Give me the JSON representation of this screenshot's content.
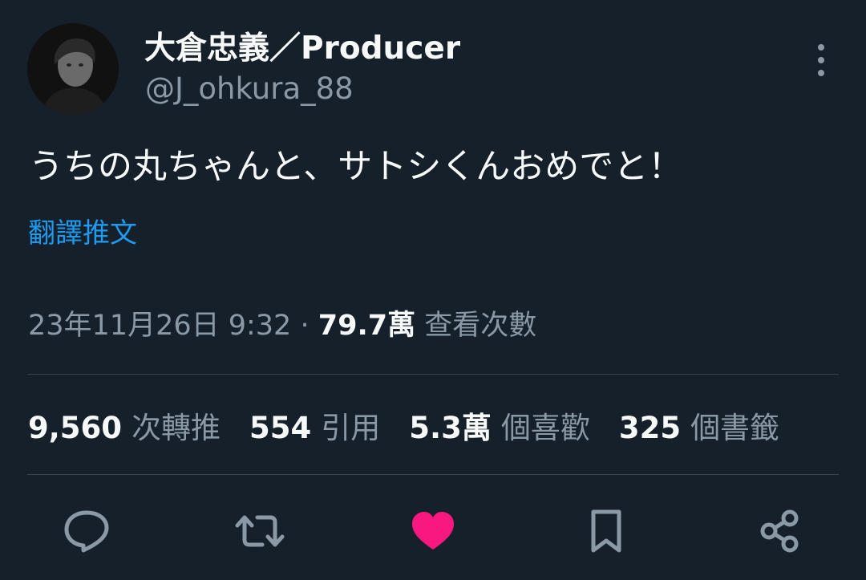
{
  "author": {
    "display_name": "大倉忠義／Producer",
    "handle": "@J_ohkura_88"
  },
  "tweet": {
    "text": "うちの丸ちゃんと、サトシくんおめでと！",
    "translate_label": "翻譯推文"
  },
  "meta": {
    "timestamp": "23年11月26日 9:32",
    "separator": "·",
    "views_count": "79.7萬",
    "views_label": "查看次數"
  },
  "stats": {
    "reposts_count": "9,560",
    "reposts_label": "次轉推",
    "quotes_count": "554",
    "quotes_label": "引用",
    "likes_count": "5.3萬",
    "likes_label": "個喜歡",
    "bookmarks_count": "325",
    "bookmarks_label": "個書籤"
  },
  "icons": {
    "more": "more-vertical-icon",
    "reply": "reply-icon",
    "retweet": "retweet-icon",
    "like": "heart-icon",
    "bookmark": "bookmark-icon",
    "share": "share-icon"
  },
  "colors": {
    "background": "#15202b",
    "primary_text": "#f7f9f9",
    "secondary_text": "#8b98a5",
    "link": "#1d9bf0",
    "like_active": "#f91880",
    "divider": "#38444d"
  }
}
